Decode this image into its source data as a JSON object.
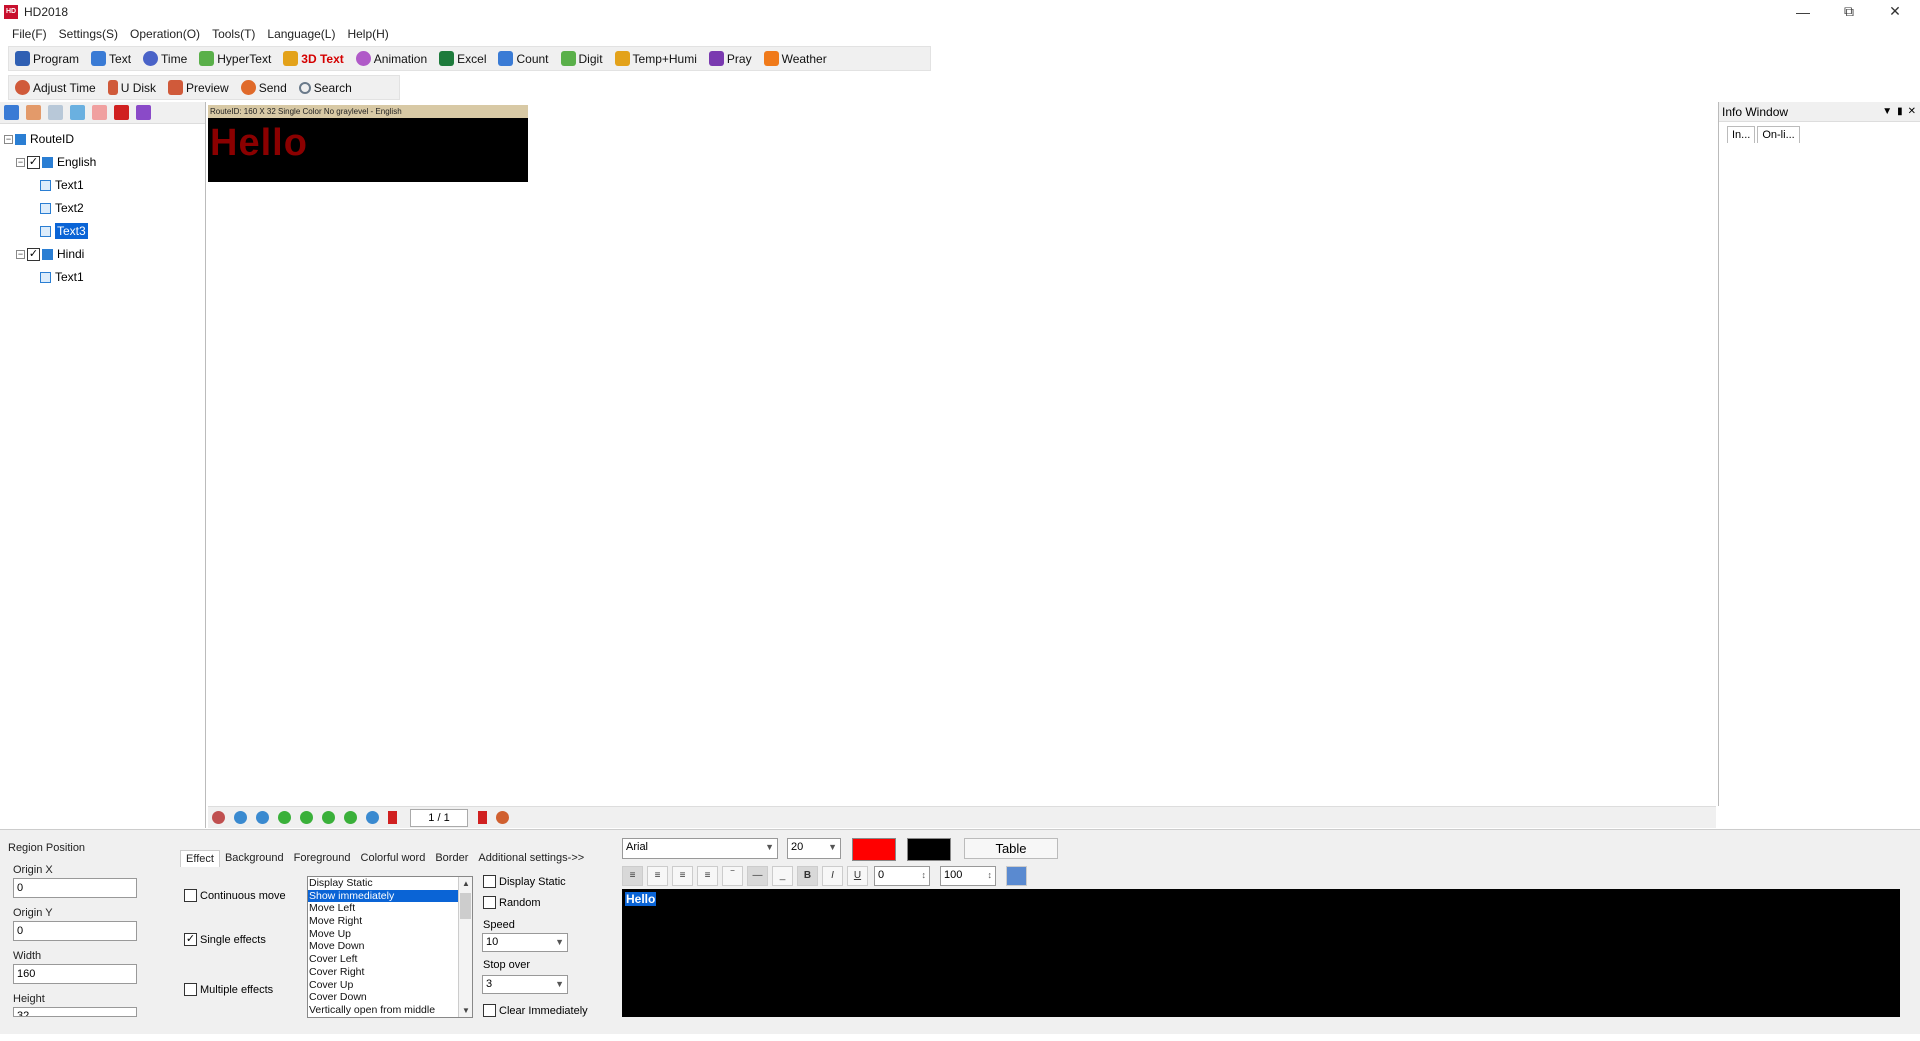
{
  "window": {
    "title": "HD2018",
    "icon_text": "HD"
  },
  "menu": [
    "File(F)",
    "Settings(S)",
    "Operation(O)",
    "Tools(T)",
    "Language(L)",
    "Help(H)"
  ],
  "toolbar1": [
    {
      "label": "Program",
      "icon": "program-icon",
      "color": "#2f5fb3"
    },
    {
      "label": "Text",
      "icon": "text-icon",
      "color": "#3a7bd5"
    },
    {
      "label": "Time",
      "icon": "clock-icon",
      "color": "#4a63c8"
    },
    {
      "label": "HyperText",
      "icon": "hypertext-icon",
      "color": "#5ab04a"
    },
    {
      "label": "3D Text",
      "icon": "cube-icon",
      "color": "#e3a21a"
    },
    {
      "label": "Animation",
      "icon": "animation-icon",
      "color": "#b05ac8"
    },
    {
      "label": "Excel",
      "icon": "excel-icon",
      "color": "#1e7b3c"
    },
    {
      "label": "Count",
      "icon": "count-icon",
      "color": "#3a7bd5"
    },
    {
      "label": "Digit",
      "icon": "digit-icon",
      "color": "#5ab04a"
    },
    {
      "label": "Temp+Humi",
      "icon": "thermometer-icon",
      "color": "#e3a21a"
    },
    {
      "label": "Pray",
      "icon": "pray-icon",
      "color": "#7a3ab0"
    },
    {
      "label": "Weather",
      "icon": "weather-icon",
      "color": "#f07a1a"
    }
  ],
  "toolbar2": [
    {
      "label": "Adjust Time",
      "icon": "adjust-time-icon",
      "color": "#d05a3a"
    },
    {
      "label": "U Disk",
      "icon": "usb-disk-icon",
      "color": "#d05a3a"
    },
    {
      "label": "Preview",
      "icon": "preview-icon",
      "color": "#d05a3a"
    },
    {
      "label": "Send",
      "icon": "send-icon",
      "color": "#e06a2a"
    },
    {
      "label": "Search",
      "icon": "search-icon",
      "color": "#6a7a8a"
    }
  ],
  "tree": {
    "root": "RouteID",
    "groups": [
      {
        "label": "English",
        "items": [
          "Text1",
          "Text2",
          "Text3"
        ]
      },
      {
        "label": "Hindi",
        "items": [
          "Text1"
        ]
      }
    ],
    "selected": "Text3"
  },
  "preview": {
    "header": "RouteID: 160 X 32  Single Color No graylevel - English",
    "text": "Hello",
    "text_color": "#8b0000"
  },
  "canvas_toolbar": {
    "page": "1 / 1"
  },
  "info_window": {
    "title": "Info Window",
    "tabs": [
      "In...",
      "On-li..."
    ]
  },
  "region": {
    "title": "Region Position",
    "origin_x_label": "Origin X",
    "origin_x": "0",
    "origin_y_label": "Origin Y",
    "origin_y": "0",
    "width_label": "Width",
    "width": "160",
    "height_label": "Height",
    "height": "32"
  },
  "effect_tabs": [
    "Effect",
    "Background",
    "Foreground",
    "Colorful word",
    "Border",
    "Additional settings->>"
  ],
  "effect_options": {
    "continuous_move": "Continuous move",
    "single_effects": "Single effects",
    "multiple_effects": "Multiple effects"
  },
  "effect_list": [
    "Display Static",
    "Show immediately",
    "Move Left",
    "Move Right",
    "Move Up",
    "Move Down",
    "Cover Left",
    "Cover Right",
    "Cover Up",
    "Cover Down",
    "Vertically open from middle"
  ],
  "effect_selected": "Show immediately",
  "effect_settings": {
    "display_static": "Display Static",
    "random": "Random",
    "speed_label": "Speed",
    "speed": "10",
    "stop_over_label": "Stop over",
    "stop_over": "3",
    "clear_immediately": "Clear Immediately"
  },
  "text_format": {
    "font": "Arial",
    "size": "20",
    "fore_color": "#ff0000",
    "back_color": "#000000",
    "table_label": "Table",
    "spacing": "0",
    "scale": "100"
  },
  "editor": {
    "text": "Hello"
  }
}
